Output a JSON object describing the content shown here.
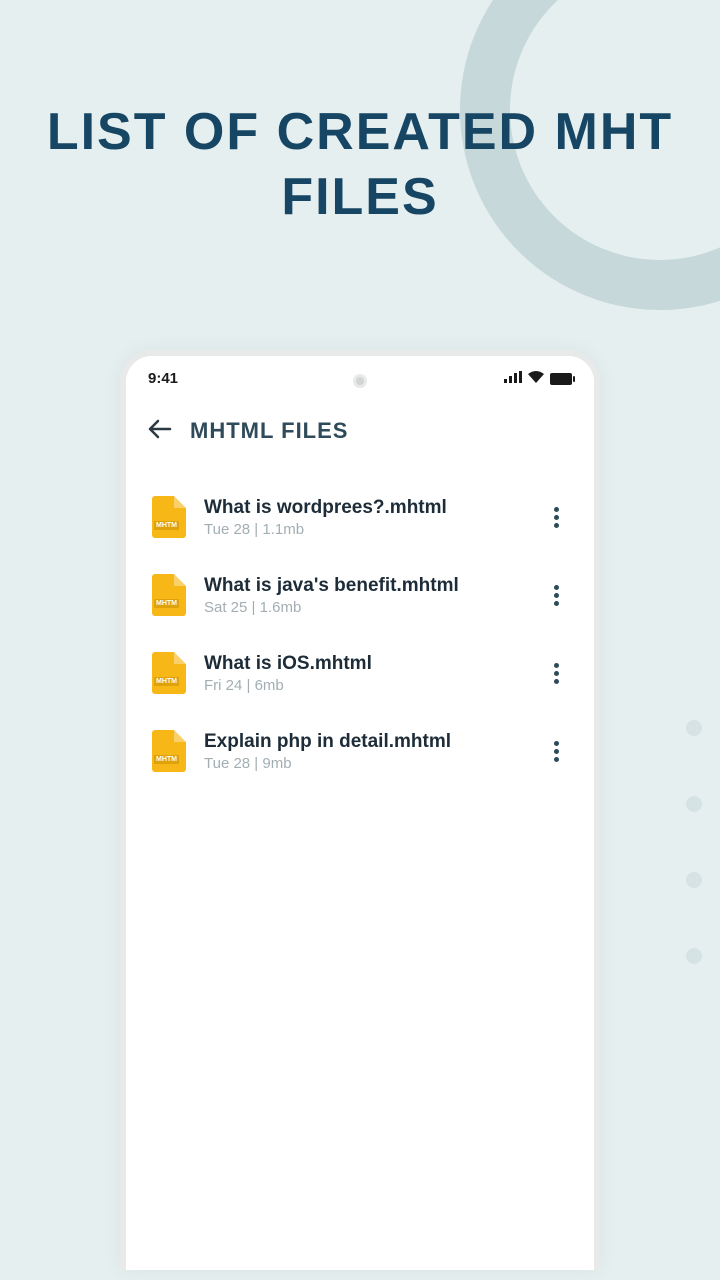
{
  "promo": {
    "title": "LIST OF CREATED MHT FILES"
  },
  "status_bar": {
    "time": "9:41"
  },
  "header": {
    "title": "MHTML FILES"
  },
  "file_icon_label": "MHTM",
  "files": [
    {
      "name": "What is wordprees?.mhtml",
      "meta": "Tue 28 | 1.1mb"
    },
    {
      "name": "What is java's benefit.mhtml",
      "meta": "Sat 25 | 1.6mb"
    },
    {
      "name": "What is iOS.mhtml",
      "meta": "Fri 24 | 6mb"
    },
    {
      "name": "Explain php in detail.mhtml",
      "meta": "Tue 28 | 9mb"
    }
  ]
}
